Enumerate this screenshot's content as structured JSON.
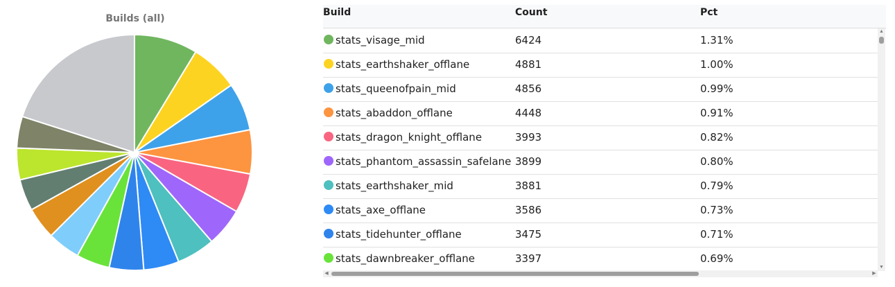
{
  "chart_data": {
    "type": "pie",
    "title": "Builds (all)",
    "slices": [
      {
        "label": "stats_visage_mid",
        "value": 6424,
        "color": "#70b65f"
      },
      {
        "label": "stats_earthshaker_offlane",
        "value": 4881,
        "color": "#fdd322"
      },
      {
        "label": "stats_queenofpain_mid",
        "value": 4856,
        "color": "#3ea2ea"
      },
      {
        "label": "stats_abaddon_offlane",
        "value": 4448,
        "color": "#fd9440"
      },
      {
        "label": "stats_dragon_knight_offlane",
        "value": 3993,
        "color": "#f96581"
      },
      {
        "label": "stats_phantom_assassin_safelane",
        "value": 3899,
        "color": "#9f66fb"
      },
      {
        "label": "stats_earthshaker_mid",
        "value": 3881,
        "color": "#4dc0bf"
      },
      {
        "label": "stats_axe_offlane",
        "value": 3586,
        "color": "#2e8af5"
      },
      {
        "label": "stats_tidehunter_offlane",
        "value": 3475,
        "color": "#2f84ec"
      },
      {
        "label": "stats_dawnbreaker_offlane",
        "value": 3397,
        "color": "#69e33a"
      },
      {
        "label": "",
        "value": 3300,
        "color": "#7fcdfb"
      },
      {
        "label": "",
        "value": 3250,
        "color": "#e0901e"
      },
      {
        "label": "",
        "value": 3200,
        "color": "#627e70"
      },
      {
        "label": "",
        "value": 3200,
        "color": "#bce52e"
      },
      {
        "label": "",
        "value": 3200,
        "color": "#7f8367"
      },
      {
        "label": "",
        "value": 14800,
        "color": "#c8c9cd"
      }
    ]
  },
  "table": {
    "headers": {
      "build": "Build",
      "count": "Count",
      "pct": "Pct"
    },
    "rows": [
      {
        "build": "stats_visage_mid",
        "count": "6424",
        "pct": "1.31%",
        "color": "#70b65f"
      },
      {
        "build": "stats_earthshaker_offlane",
        "count": "4881",
        "pct": "1.00%",
        "color": "#fdd322"
      },
      {
        "build": "stats_queenofpain_mid",
        "count": "4856",
        "pct": "0.99%",
        "color": "#3ea2ea"
      },
      {
        "build": "stats_abaddon_offlane",
        "count": "4448",
        "pct": "0.91%",
        "color": "#fd9440"
      },
      {
        "build": "stats_dragon_knight_offlane",
        "count": "3993",
        "pct": "0.82%",
        "color": "#f96581"
      },
      {
        "build": "stats_phantom_assassin_safelane",
        "count": "3899",
        "pct": "0.80%",
        "color": "#9f66fb"
      },
      {
        "build": "stats_earthshaker_mid",
        "count": "3881",
        "pct": "0.79%",
        "color": "#4dc0bf"
      },
      {
        "build": "stats_axe_offlane",
        "count": "3586",
        "pct": "0.73%",
        "color": "#2e8af5"
      },
      {
        "build": "stats_tidehunter_offlane",
        "count": "3475",
        "pct": "0.71%",
        "color": "#2f84ec"
      },
      {
        "build": "stats_dawnbreaker_offlane",
        "count": "3397",
        "pct": "0.69%",
        "color": "#69e33a"
      }
    ]
  },
  "scrollbars": {
    "up_icon": "▲",
    "down_icon": "▼",
    "left_icon": "◀",
    "right_icon": "▶"
  }
}
